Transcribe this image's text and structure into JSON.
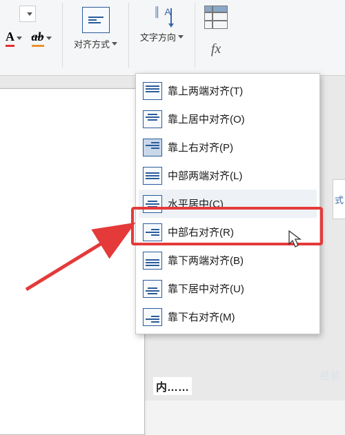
{
  "ribbon": {
    "align": {
      "label": "对齐方式"
    },
    "text_direction": {
      "label": "文字方向"
    },
    "fx_label": "fx"
  },
  "menu": {
    "items": [
      {
        "label": "靠上两端对齐(T)",
        "halign": "justify",
        "valign": "top"
      },
      {
        "label": "靠上居中对齐(O)",
        "halign": "center",
        "valign": "top"
      },
      {
        "label": "靠上右对齐(P)",
        "halign": "right",
        "valign": "top",
        "selected": true
      },
      {
        "label": "中部两端对齐(L)",
        "halign": "justify",
        "valign": "mid"
      },
      {
        "label": "水平居中(C)",
        "halign": "center",
        "valign": "mid",
        "hovered": true,
        "highlighted": true
      },
      {
        "label": "中部右对齐(R)",
        "halign": "right",
        "valign": "mid"
      },
      {
        "label": "靠下两端对齐(B)",
        "halign": "justify",
        "valign": "bot"
      },
      {
        "label": "靠下居中对齐(U)",
        "halign": "center",
        "valign": "bot"
      },
      {
        "label": "靠下右对齐(M)",
        "halign": "right",
        "valign": "bot"
      }
    ]
  },
  "right_panel_frag": "式",
  "watermark": "经验",
  "bottom_text": "内……"
}
